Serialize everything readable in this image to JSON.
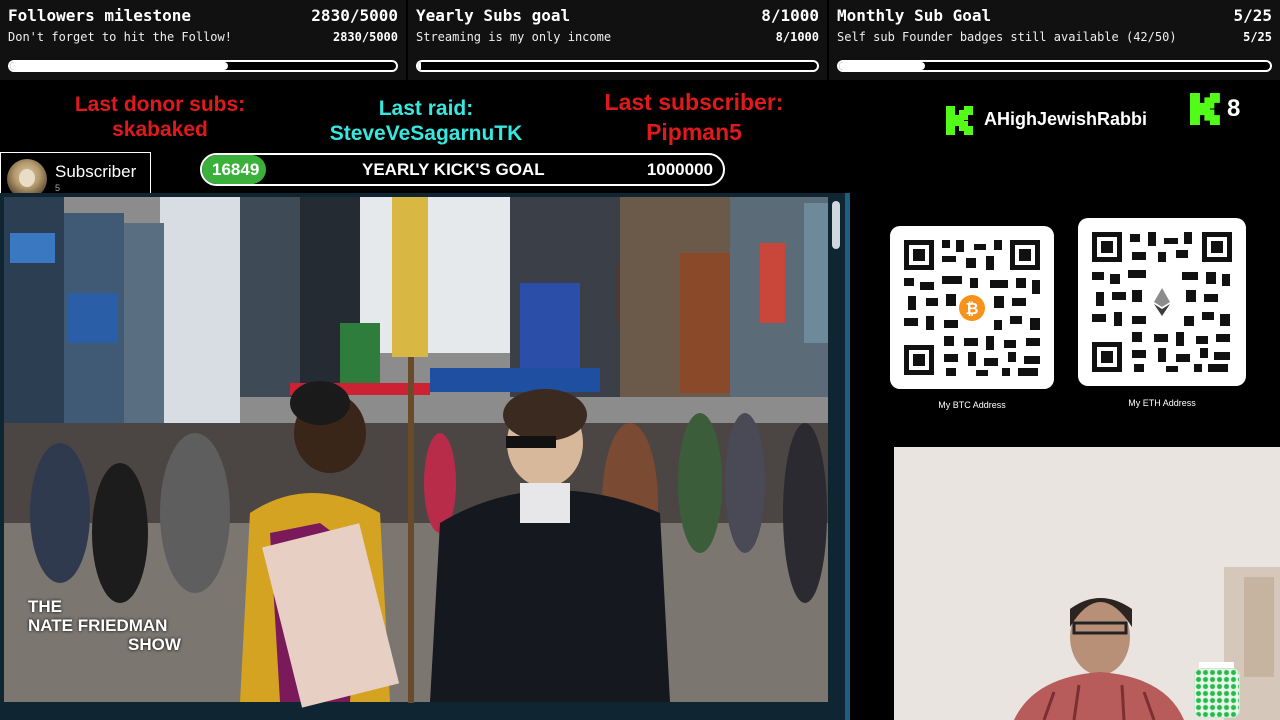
{
  "goals": [
    {
      "title": "Followers milestone",
      "count": "2830/5000",
      "subtitle": "Don't forget to hit the Follow!",
      "count2": "2830/5000",
      "progress": 0.566
    },
    {
      "title": "Yearly Subs goal",
      "count": "8/1000",
      "subtitle": "Streaming is my only income",
      "count2": "8/1000",
      "progress": 0.008
    },
    {
      "title": "Monthly Sub Goal",
      "count": "5/25",
      "subtitle": "Self sub Founder badges still available (42/50)",
      "count2": "5/25",
      "progress": 0.2
    }
  ],
  "alerts": {
    "donor_label": "Last donor subs:",
    "donor_name": "skabaked",
    "raid_label": "Last raid:",
    "raid_name": "SteveVeSagarnuTK",
    "subscriber_label": "Last subscriber:",
    "subscriber_name": "Pipman5"
  },
  "channel": {
    "name": "AHighJewishRabbi",
    "kick_count": "8",
    "brand_color": "#53fc18"
  },
  "subscriber_box": {
    "label": "Subscriber",
    "count": "5"
  },
  "kick_goal": {
    "current": "16849",
    "label": "YEARLY KICK'S GOAL",
    "target": "1000000",
    "progress": 0.0168
  },
  "video": {
    "watermark_line1": "THE",
    "watermark_line2": "NATE FRIEDMAN",
    "watermark_line3": "SHOW"
  },
  "qr": {
    "btc_label": "My BTC Address",
    "eth_label": "My ETH Address",
    "btc_icon": "bitcoin-icon",
    "eth_icon": "ethereum-icon"
  },
  "colors": {
    "alert_red": "#e0191b",
    "alert_cyan": "#35e8e0",
    "progress_green": "#3bb13b",
    "bitcoin_orange": "#f7931a"
  }
}
